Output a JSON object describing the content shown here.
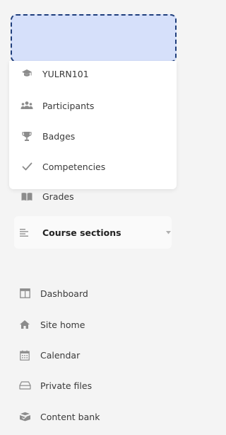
{
  "course_nav": {
    "items": [
      {
        "label": "YULRN101",
        "icon": "graduation-cap-icon"
      },
      {
        "label": "Participants",
        "icon": "users-icon"
      },
      {
        "label": "Badges",
        "icon": "trophy-icon"
      },
      {
        "label": "Competencies",
        "icon": "checkmark-icon"
      },
      {
        "label": "Grades",
        "icon": "book-icon"
      }
    ],
    "sections": {
      "label": "Course sections",
      "icon": "list-icon"
    }
  },
  "site_nav": {
    "items": [
      {
        "label": "Dashboard",
        "icon": "dashboard-icon"
      },
      {
        "label": "Site home",
        "icon": "home-icon"
      },
      {
        "label": "Calendar",
        "icon": "calendar-icon"
      },
      {
        "label": "Private files",
        "icon": "drive-icon"
      },
      {
        "label": "Content bank",
        "icon": "content-bank-icon"
      }
    ]
  },
  "colors": {
    "drop_zone_fill": "#d6e0fa",
    "drop_zone_border": "#1f3e7c",
    "icon": "#8c8c8c"
  }
}
